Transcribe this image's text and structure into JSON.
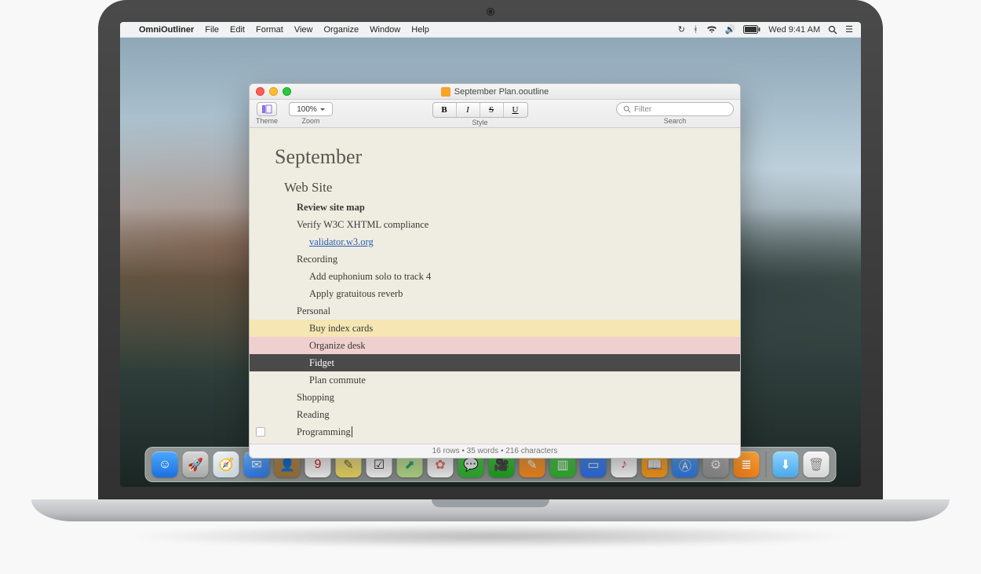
{
  "menubar": {
    "apple": "",
    "app": "OmniOutliner",
    "items": [
      "File",
      "Edit",
      "Format",
      "View",
      "Organize",
      "Window",
      "Help"
    ],
    "clock": "Wed 9:41 AM"
  },
  "window": {
    "title": "September Plan.ooutline",
    "toolbar": {
      "theme_label": "Theme",
      "zoom_value": "100%",
      "zoom_label": "Zoom",
      "style_label": "Style",
      "style_buttons": {
        "bold": "B",
        "italic": "I",
        "strike": "S",
        "underline": "U"
      },
      "search_placeholder": "Filter",
      "search_label": "Search"
    },
    "document": {
      "title": "September",
      "rows": [
        {
          "level": "h1",
          "text": "Web Site"
        },
        {
          "level": "h2",
          "bold": true,
          "text": "Review site map"
        },
        {
          "level": "h3",
          "text": "Verify W3C XHTML compliance"
        },
        {
          "level": "item",
          "link": true,
          "text": "validator.w3.org"
        },
        {
          "level": "h2",
          "text": "Recording"
        },
        {
          "level": "item",
          "text": "Add euphonium solo to track 4"
        },
        {
          "level": "item",
          "text": "Apply gratuitous reverb"
        },
        {
          "level": "h2",
          "text": "Personal"
        },
        {
          "level": "item",
          "text": "Buy index cards",
          "hl": "yellow"
        },
        {
          "level": "item",
          "text": "Organize desk",
          "hl": "pink"
        },
        {
          "level": "item",
          "text": "Fidget",
          "selected": true
        },
        {
          "level": "item",
          "text": "Plan commute"
        },
        {
          "level": "h2",
          "text": "Shopping"
        },
        {
          "level": "h2",
          "text": "Reading"
        },
        {
          "level": "h2",
          "text": "Programming",
          "editing": true,
          "handle": true
        }
      ]
    },
    "status": "16 rows • 35 words • 216 characters"
  },
  "dock": [
    {
      "name": "finder",
      "bg": "linear-gradient(#4aa8ff,#1d6fe0)",
      "glyph": "☺"
    },
    {
      "name": "launchpad",
      "bg": "linear-gradient(#d8d8d8,#a8a8a8)",
      "glyph": "🚀"
    },
    {
      "name": "safari",
      "bg": "linear-gradient(#eef3f8,#cdd8e4)",
      "glyph": "🧭"
    },
    {
      "name": "mail",
      "bg": "linear-gradient(#6fb8ff,#2e79e8)",
      "glyph": "✉"
    },
    {
      "name": "contacts",
      "bg": "linear-gradient(#c9a46e,#a3783b)",
      "glyph": "👤"
    },
    {
      "name": "calendar",
      "bg": "#ffffff",
      "glyph": "9",
      "fg": "#d23"
    },
    {
      "name": "notes",
      "bg": "linear-gradient(#fff3a8,#f6de5e)",
      "glyph": "✎",
      "fg": "#7a6a2a"
    },
    {
      "name": "reminders",
      "bg": "#ffffff",
      "glyph": "☑",
      "fg": "#333"
    },
    {
      "name": "maps",
      "bg": "linear-gradient(#d9efb0,#b9e48a)",
      "glyph": "⬈",
      "fg": "#3a7"
    },
    {
      "name": "photos",
      "bg": "#ffffff",
      "glyph": "✿",
      "fg": "#e76"
    },
    {
      "name": "messages",
      "bg": "linear-gradient(#6be36b,#2bb52b)",
      "glyph": "💬"
    },
    {
      "name": "facetime",
      "bg": "linear-gradient(#5be35b,#1ea81e)",
      "glyph": "🎥"
    },
    {
      "name": "pages",
      "bg": "linear-gradient(#ffb24a,#ff8a1f)",
      "glyph": "✎"
    },
    {
      "name": "numbers",
      "bg": "linear-gradient(#6cdc6c,#2fb52f)",
      "glyph": "▥"
    },
    {
      "name": "keynote",
      "bg": "linear-gradient(#57a2ff,#2e6fe8)",
      "glyph": "▭"
    },
    {
      "name": "itunes",
      "bg": "#ffffff",
      "glyph": "♪",
      "fg": "#e46"
    },
    {
      "name": "ibooks",
      "bg": "linear-gradient(#ffbb3b,#ff9a1c)",
      "glyph": "📖"
    },
    {
      "name": "appstore",
      "bg": "linear-gradient(#6fb8ff,#2e79e8)",
      "glyph": "Ⓐ"
    },
    {
      "name": "preferences",
      "bg": "linear-gradient(#c9c9c9,#8f8f8f)",
      "glyph": "⚙"
    },
    {
      "name": "omnioutliner",
      "bg": "linear-gradient(#ffa63a,#f07e17)",
      "glyph": "≣"
    },
    {
      "sep": true
    },
    {
      "name": "downloads",
      "bg": "linear-gradient(#8fd4ff,#4aa8e8)",
      "glyph": "⬇"
    },
    {
      "name": "trash",
      "bg": "linear-gradient(#f5f5f5,#d5d5d5)",
      "glyph": "🗑",
      "fg": "#888"
    }
  ]
}
